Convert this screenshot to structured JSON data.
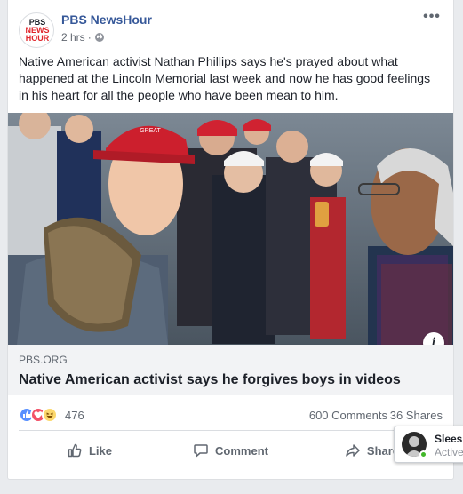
{
  "post": {
    "page_name": "PBS NewsHour",
    "timestamp": "2 hrs",
    "meta_separator": "·",
    "logo_lines": [
      "PBS",
      "NEWS",
      "HOUR"
    ],
    "text": "Native American activist Nathan Phillips says he's prayed about what happened at the Lincoln Memorial last week and now he has good feelings in his heart for all the people who have been mean to him.",
    "more_icon": "•••"
  },
  "link": {
    "domain": "PBS.ORG",
    "title": "Native American activist says he forgives boys in videos",
    "info_icon": "i"
  },
  "reactions": {
    "count": "476",
    "comments": "600 Comments",
    "shares": "36 Shares",
    "icons": [
      "like-icon",
      "love-icon",
      "haha-icon"
    ]
  },
  "actions": {
    "like": "Like",
    "comment": "Comment",
    "share": "Share"
  },
  "chat": {
    "name": "Slees",
    "status": "Active"
  },
  "colors": {
    "page_name": "#365899",
    "like": "#5890ff",
    "love": "#f25268",
    "haha": "#fcd86d",
    "active": "#42b72a"
  }
}
